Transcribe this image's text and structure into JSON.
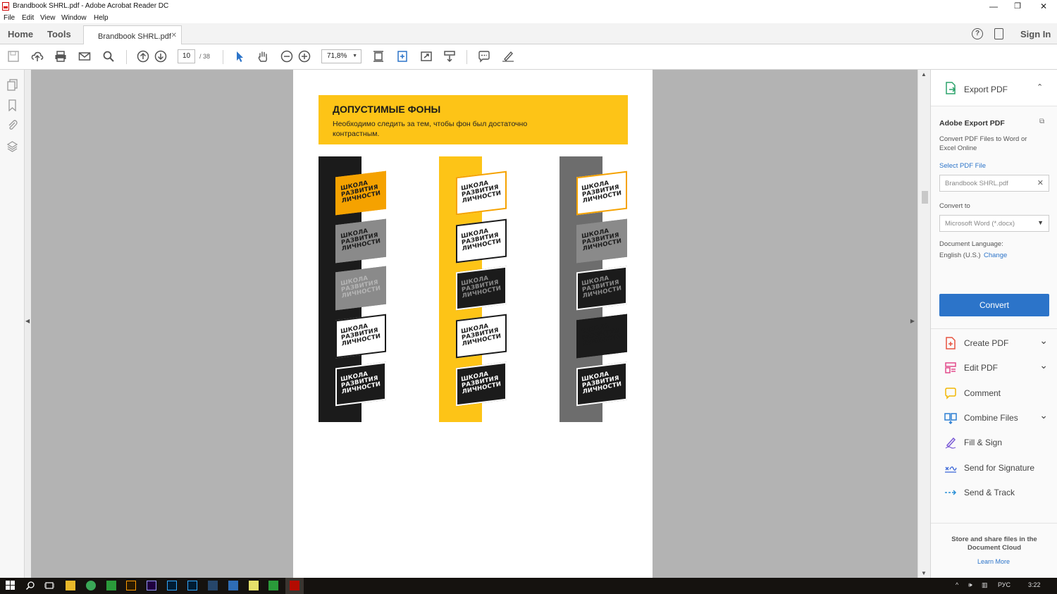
{
  "window": {
    "title": "Brandbook SHRL.pdf - Adobe Acrobat Reader DC",
    "controls": [
      "—",
      "❐",
      "✕"
    ]
  },
  "menu": [
    "File",
    "Edit",
    "View",
    "Window",
    "Help"
  ],
  "tabs": {
    "home": "Home",
    "tools": "Tools",
    "document": "Brandbook SHRL.pdf",
    "help_icon": "?",
    "sign_in": "Sign In"
  },
  "toolbar": {
    "page_current": "10",
    "page_total": "/ 38",
    "zoom": "71,8%"
  },
  "document": {
    "heading": "ДОПУСТИМЫЕ ФОНЫ",
    "subtext": "Необходимо следить за тем, чтобы фон был достаточно контрастным.",
    "logo_text_lines": [
      "ШКОЛА",
      "РАЗВИТИЯ",
      "ЛИЧНОСТИ"
    ],
    "colors": {
      "yellow": "#fdc417",
      "black": "#1b1b1b",
      "gray": "#6d6d6d"
    }
  },
  "right_panel": {
    "export_pdf": "Export PDF",
    "adobe_export_title": "Adobe Export PDF",
    "adobe_export_desc": "Convert PDF Files to Word or Excel Online",
    "select_pdf_file": "Select PDF File",
    "selected_file": "Brandbook SHRL.pdf",
    "convert_to_label": "Convert to",
    "convert_to_value": "Microsoft Word (*.docx)",
    "doc_language_label": "Document Language:",
    "doc_language_value": "English (U.S.)",
    "change_link": "Change",
    "convert_button": "Convert",
    "tools": [
      {
        "label": "Create PDF",
        "icon": "create-pdf-icon",
        "chevron": true,
        "color": "#e8533f"
      },
      {
        "label": "Edit PDF",
        "icon": "edit-pdf-icon",
        "chevron": true,
        "color": "#e24b8b"
      },
      {
        "label": "Comment",
        "icon": "comment-icon",
        "chevron": false,
        "color": "#f2b705"
      },
      {
        "label": "Combine Files",
        "icon": "combine-files-icon",
        "chevron": true,
        "color": "#2d7fd3"
      },
      {
        "label": "Fill & Sign",
        "icon": "fill-sign-icon",
        "chevron": false,
        "color": "#7b5bd6"
      },
      {
        "label": "Send for Signature",
        "icon": "send-signature-icon",
        "chevron": false,
        "color": "#3f6ad8"
      },
      {
        "label": "Send & Track",
        "icon": "send-track-icon",
        "chevron": false,
        "color": "#2a8fd6"
      }
    ],
    "store_share": "Store and share files in the Document Cloud",
    "learn_more": "Learn More"
  },
  "taskbar": {
    "language": "РУС",
    "time": "3:22"
  },
  "accent_blue": "#2c74c9"
}
